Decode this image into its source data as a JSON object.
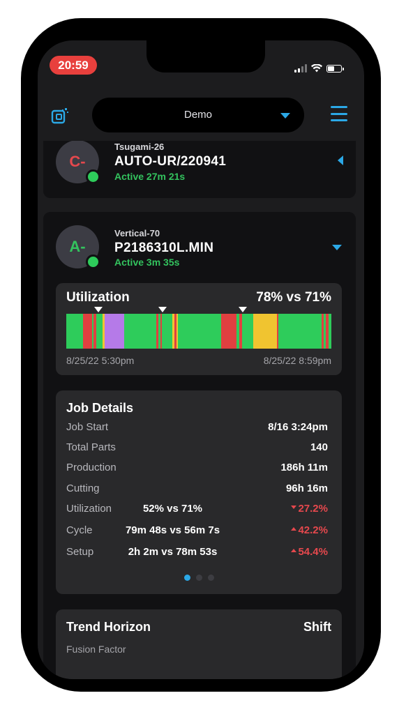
{
  "status_bar": {
    "time": "20:59"
  },
  "header": {
    "selector_label": "Demo"
  },
  "machines": [
    {
      "initial": "C-",
      "avatar_color": "#e5484d",
      "model": "Tsugami-26",
      "job": "AUTO-UR/220941",
      "status": "Active 27m 21s"
    },
    {
      "initial": "A-",
      "avatar_color": "#33c35e",
      "model": "Vertical-70",
      "job": "P2186310L.MIN",
      "status": "Active 3m 35s"
    }
  ],
  "utilization": {
    "title": "Utilization",
    "value": "78% vs 71%",
    "start": "8/25/22 5:30pm",
    "end": "8/25/22 8:59pm"
  },
  "job_details": {
    "title": "Job Details",
    "rows": {
      "job_start": {
        "label": "Job Start",
        "value": "8/16 3:24pm"
      },
      "total_parts": {
        "label": "Total Parts",
        "value": "140"
      },
      "production": {
        "label": "Production",
        "value": "186h 11m"
      },
      "cutting": {
        "label": "Cutting",
        "value": "96h 16m"
      },
      "utilization": {
        "label": "Utilization",
        "compare": "52% vs 71%",
        "delta": "27.2%",
        "direction": "down"
      },
      "cycle": {
        "label": "Cycle",
        "compare": "79m 48s vs 56m 7s",
        "delta": "42.2%",
        "direction": "up"
      },
      "setup": {
        "label": "Setup",
        "compare": "2h 2m vs 78m 53s",
        "delta": "54.4%",
        "direction": "up"
      }
    }
  },
  "trend_horizon": {
    "title": "Trend Horizon",
    "value": "Shift",
    "subtitle": "Fusion Factor"
  },
  "colors": {
    "accent": "#2ba8e6",
    "running": "#2ecc5b",
    "down": "#e04040",
    "idle": "#f0c430",
    "setup": "#b57ae8",
    "negative": "#e5484d"
  }
}
